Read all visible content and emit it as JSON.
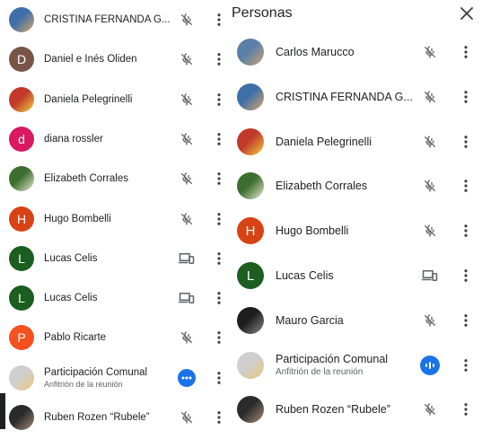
{
  "left_panel": {
    "participants": [
      {
        "name": "CRISTINA FERNANDA G...",
        "avatar_type": "photo",
        "avatar_colors": [
          "#3f6fa8",
          "#d9a66a"
        ],
        "status": "muted"
      },
      {
        "name": "Daniel e Inés Oliden",
        "avatar_type": "letter",
        "letter": "D",
        "avatar_color": "#795548",
        "status": "muted"
      },
      {
        "name": "Daniela Pelegrinelli",
        "avatar_type": "photo",
        "avatar_colors": [
          "#c0392b",
          "#f4d03f"
        ],
        "status": "muted"
      },
      {
        "name": "diana rossler",
        "avatar_type": "letter",
        "letter": "d",
        "avatar_color": "#d81b60",
        "status": "muted"
      },
      {
        "name": "Elizabeth Corrales",
        "avatar_type": "photo",
        "avatar_colors": [
          "#3c6e2f",
          "#e8e8d0"
        ],
        "status": "muted"
      },
      {
        "name": "Hugo Bombelli",
        "avatar_type": "letter",
        "letter": "H",
        "avatar_color": "#d84315",
        "status": "muted"
      },
      {
        "name": "Lucas Celis",
        "avatar_type": "letter",
        "letter": "L",
        "avatar_color": "#1b5e20",
        "status": "devices"
      },
      {
        "name": "Lucas Celis",
        "avatar_type": "letter",
        "letter": "L",
        "avatar_color": "#1b5e20",
        "status": "devices"
      },
      {
        "name": "Pablo Ricarte",
        "avatar_type": "letter",
        "letter": "P",
        "avatar_color": "#f4511e",
        "status": "muted"
      },
      {
        "name": "Participación Comunal",
        "subtitle": "Anfitrión de la reunión",
        "avatar_type": "photo",
        "avatar_colors": [
          "#cfcfcf",
          "#e8c878"
        ],
        "status": "options"
      },
      {
        "name": "Ruben Rozen “Rubele”",
        "avatar_type": "photo",
        "avatar_colors": [
          "#2b2b2b",
          "#a58a73"
        ],
        "status": "muted"
      }
    ]
  },
  "right_panel": {
    "title": "Personas",
    "participants": [
      {
        "name": "Carlos Marucco",
        "avatar_type": "photo",
        "avatar_colors": [
          "#5b7fa6",
          "#c9a27a"
        ],
        "status": "muted"
      },
      {
        "name": "CRISTINA FERNANDA G...",
        "avatar_type": "photo",
        "avatar_colors": [
          "#3f6fa8",
          "#d9a66a"
        ],
        "status": "muted"
      },
      {
        "name": "Daniela Pelegrinelli",
        "avatar_type": "photo",
        "avatar_colors": [
          "#c0392b",
          "#f4d03f"
        ],
        "status": "muted"
      },
      {
        "name": "Elizabeth Corrales",
        "avatar_type": "photo",
        "avatar_colors": [
          "#3c6e2f",
          "#e8e8d0"
        ],
        "status": "muted"
      },
      {
        "name": "Hugo Bombelli",
        "avatar_type": "letter",
        "letter": "H",
        "avatar_color": "#d84315",
        "status": "muted"
      },
      {
        "name": "Lucas Celis",
        "avatar_type": "letter",
        "letter": "L",
        "avatar_color": "#1b5e20",
        "status": "devices"
      },
      {
        "name": "Mauro Garcia",
        "avatar_type": "photo",
        "avatar_colors": [
          "#1e1e1e",
          "#8a8a8a"
        ],
        "status": "muted"
      },
      {
        "name": "Participación Comunal",
        "subtitle": "Anfitrión de la reunión",
        "avatar_type": "photo",
        "avatar_colors": [
          "#cfcfcf",
          "#e8c878"
        ],
        "status": "speaking"
      },
      {
        "name": "Ruben Rozen “Rubele”",
        "avatar_type": "photo",
        "avatar_colors": [
          "#2b2b2b",
          "#a58a73"
        ],
        "status": "muted"
      }
    ]
  },
  "colors": {
    "accent": "#1a73e8",
    "icon_gray": "#5f6368",
    "text": "#202124"
  }
}
